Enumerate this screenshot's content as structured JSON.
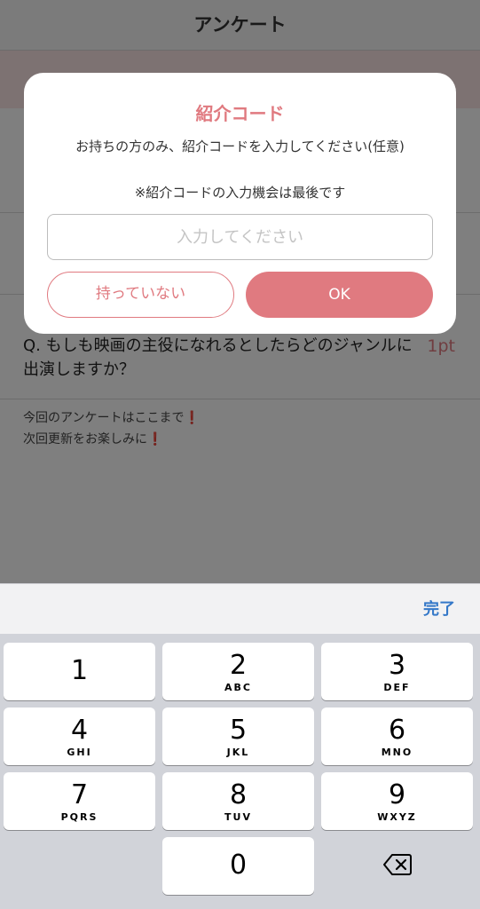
{
  "nav": {
    "title": "アンケート"
  },
  "question": {
    "text": "Q. もしも映画の主役になれるとしたらどのジャンルに出演しますか？",
    "points": "1pt"
  },
  "end_note": {
    "line1": "今回のアンケートはここまで",
    "line2": "次回更新をお楽しみに"
  },
  "dialog": {
    "title": "紹介コード",
    "message": "お持ちの方のみ、紹介コードを入力してください(任意)",
    "note": "※紹介コードの入力機会は最後です",
    "input_placeholder": "入力してください",
    "input_value": "",
    "cancel_label": "持っていない",
    "ok_label": "OK"
  },
  "keyboard": {
    "done_label": "完了",
    "keys": [
      {
        "num": "1",
        "letters": ""
      },
      {
        "num": "2",
        "letters": "ABC"
      },
      {
        "num": "3",
        "letters": "DEF"
      },
      {
        "num": "4",
        "letters": "GHI"
      },
      {
        "num": "5",
        "letters": "JKL"
      },
      {
        "num": "6",
        "letters": "MNO"
      },
      {
        "num": "7",
        "letters": "PQRS"
      },
      {
        "num": "8",
        "letters": "TUV"
      },
      {
        "num": "9",
        "letters": "WXYZ"
      },
      {
        "num": "0",
        "letters": ""
      }
    ],
    "delete_icon": "backspace-icon"
  },
  "colors": {
    "accent": "#e07a80",
    "done": "#3478c8",
    "excl": "#d0021b"
  }
}
